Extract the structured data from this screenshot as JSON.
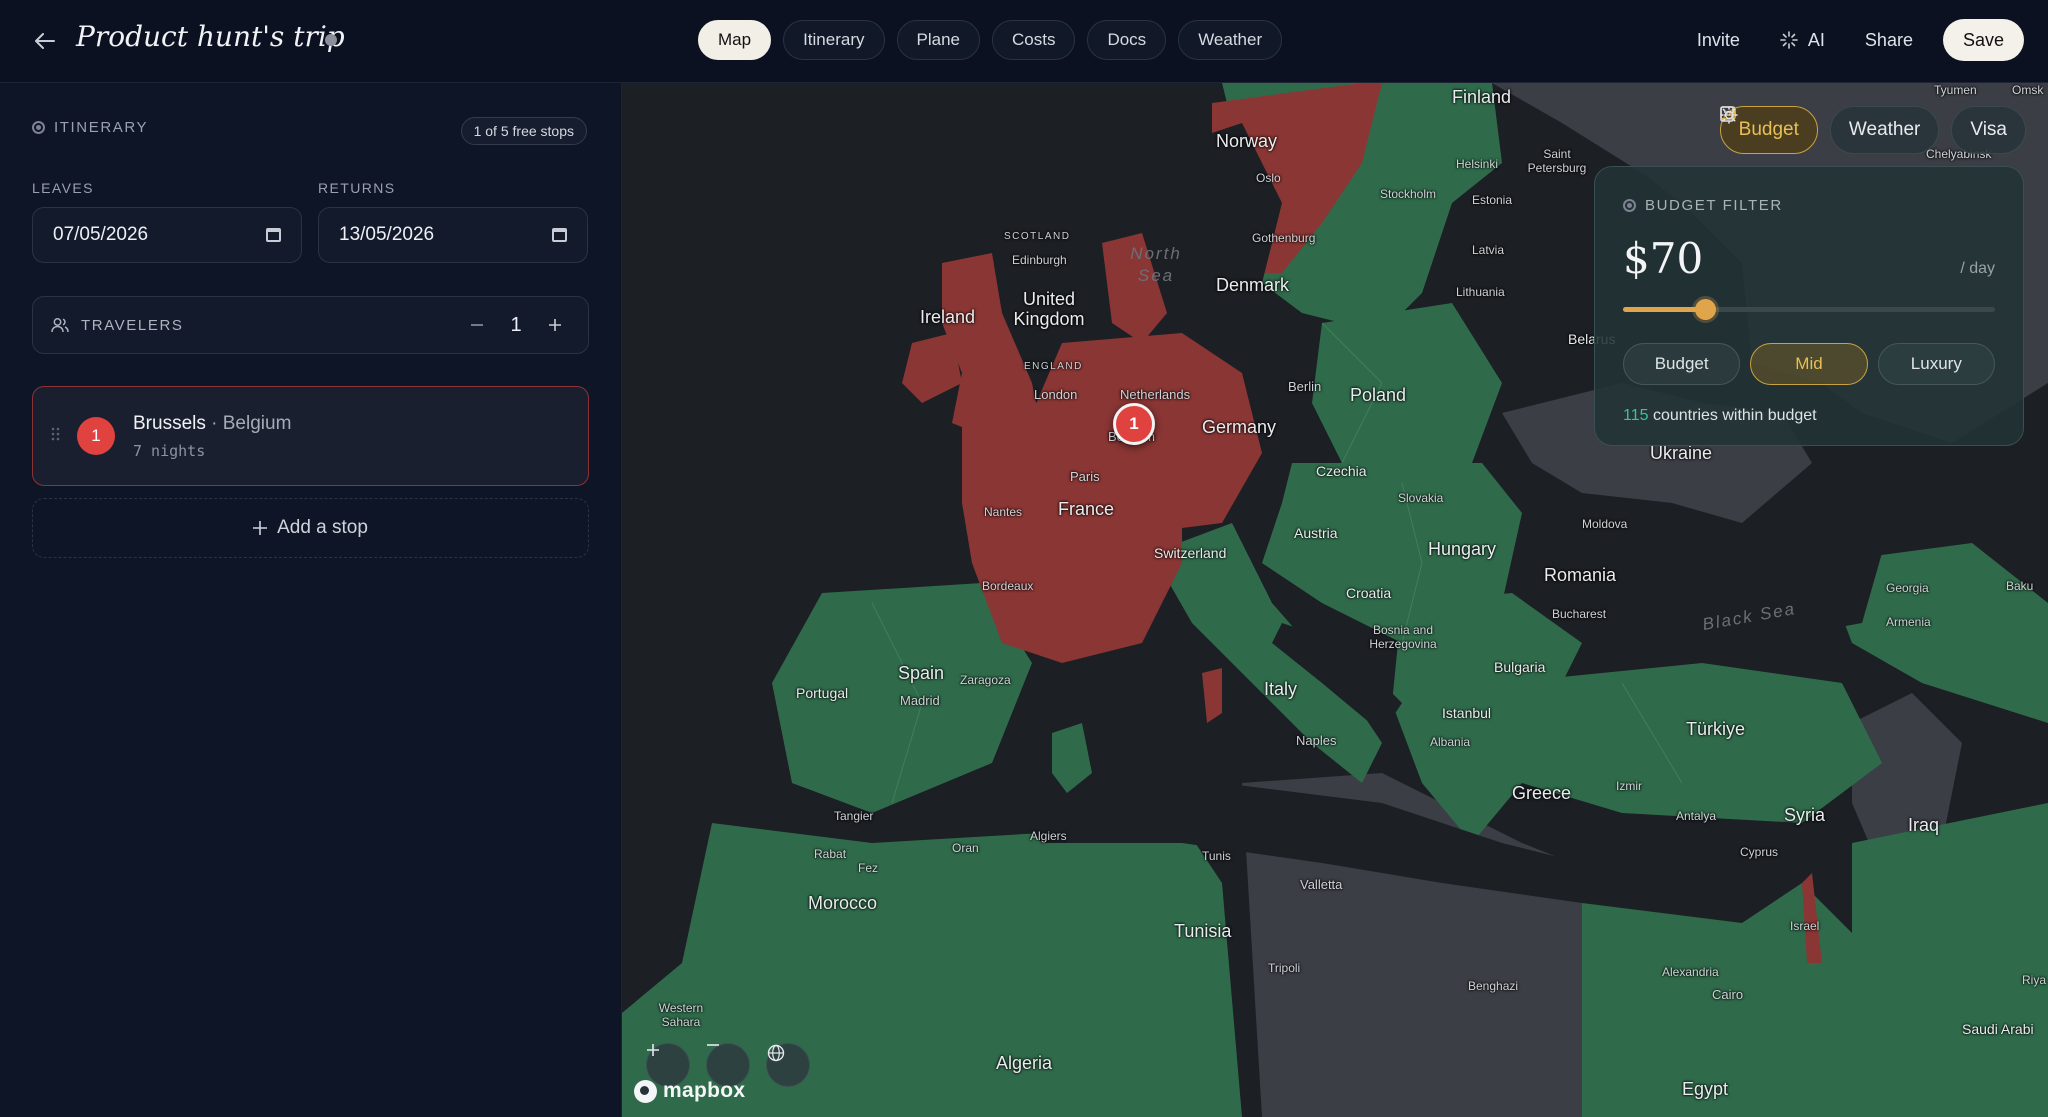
{
  "header": {
    "title": "Product hunt's trip",
    "tabs": [
      "Map",
      "Itinerary",
      "Plane",
      "Costs",
      "Docs",
      "Weather"
    ],
    "active_tab": "Map",
    "actions": {
      "invite": "Invite",
      "ai": "AI",
      "share": "Share",
      "save": "Save"
    }
  },
  "sidebar": {
    "section_label": "ITINERARY",
    "free_stops_badge": "1 of 5 free stops",
    "leaves_label": "LEAVES",
    "leaves_value": "07/05/2026",
    "returns_label": "RETURNS",
    "returns_value": "13/05/2026",
    "travelers_label": "TRAVELERS",
    "travelers_count": "1",
    "stops": [
      {
        "number": "1",
        "city": "Brussels",
        "country": "Belgium",
        "nights": "7 nights"
      }
    ],
    "add_stop_label": "Add a stop"
  },
  "map": {
    "marker_number": "1",
    "attribution": "mapbox",
    "chips": {
      "budget": "Budget",
      "weather": "Weather",
      "visa": "Visa"
    },
    "budget_filter": {
      "title": "BUDGET FILTER",
      "price": "$70",
      "unit": "/ day",
      "slider_fraction": 0.22,
      "tiers": [
        "Budget",
        "Mid",
        "Luxury"
      ],
      "active_tier": "Mid",
      "count": "115",
      "count_suffix": "countries within budget"
    },
    "labels": {
      "finland": "Finland",
      "norway": "Norway",
      "oslo": "Oslo",
      "stockholm": "Stockholm",
      "helsinki": "Helsinki",
      "saint_petersburg": "Saint Petersburg",
      "estonia": "Estonia",
      "latvia": "Latvia",
      "lithuania": "Lithuania",
      "belarus": "Belarus",
      "gothenburg": "Gothenburg",
      "denmark": "Denmark",
      "north_sea": "North Sea",
      "scotland": "SCOTLAND",
      "edinburgh": "Edinburgh",
      "united_kingdom": "United Kingdom",
      "ireland": "Ireland",
      "england": "ENGLAND",
      "london": "London",
      "netherlands": "Netherlands",
      "berlin": "Berlin",
      "poland": "Poland",
      "germany": "Germany",
      "belgium": "Belgium",
      "paris": "Paris",
      "france": "France",
      "nantes": "Nantes",
      "czechia": "Czechia",
      "slovakia": "Slovakia",
      "ukraine": "Ukraine",
      "austria": "Austria",
      "hungary": "Hungary",
      "moldova": "Moldova",
      "switzerland": "Switzerland",
      "romania": "Romania",
      "croatia": "Croatia",
      "bordeaux": "Bordeaux",
      "bosnia": "Bosnia and Herzegovina",
      "bucharest": "Bucharest",
      "black_sea": "Black Sea",
      "georgia": "Georgia",
      "armenia": "Armenia",
      "baku": "Baku",
      "spain": "Spain",
      "zaragoza": "Zaragoza",
      "madrid": "Madrid",
      "portugal": "Portugal",
      "italy": "Italy",
      "bulgaria": "Bulgaria",
      "istanbul": "Istanbul",
      "turkiye": "Türkiye",
      "naples": "Naples",
      "albania": "Albania",
      "greece": "Greece",
      "izmir": "Izmir",
      "antalya": "Antalya",
      "syria": "Syria",
      "iraq": "Iraq",
      "cyprus": "Cyprus",
      "tangier": "Tangier",
      "algiers": "Algiers",
      "oran": "Oran",
      "rabat": "Rabat",
      "fez": "Fez",
      "tunis": "Tunis",
      "morocco": "Morocco",
      "valletta": "Valletta",
      "tunisia": "Tunisia",
      "tripoli": "Tripoli",
      "benghazi": "Benghazi",
      "alexandria": "Alexandria",
      "cairo": "Cairo",
      "israel": "Israel",
      "western_sahara": "Western Sahara",
      "algeria": "Algeria",
      "egypt": "Egypt",
      "saudi_arabia": "Saudi Arabi",
      "tyumen": "Tyumen",
      "omsk": "Omsk",
      "chelyabinsk": "Chelyabinsk",
      "riya": "Riya"
    }
  },
  "colors": {
    "in_budget": "#2f6b4b",
    "over_budget": "#8a3634",
    "no_data": "#3b3e45",
    "water": "#1c1f24",
    "accent": "#e0a54a",
    "marker": "#e0433f"
  }
}
